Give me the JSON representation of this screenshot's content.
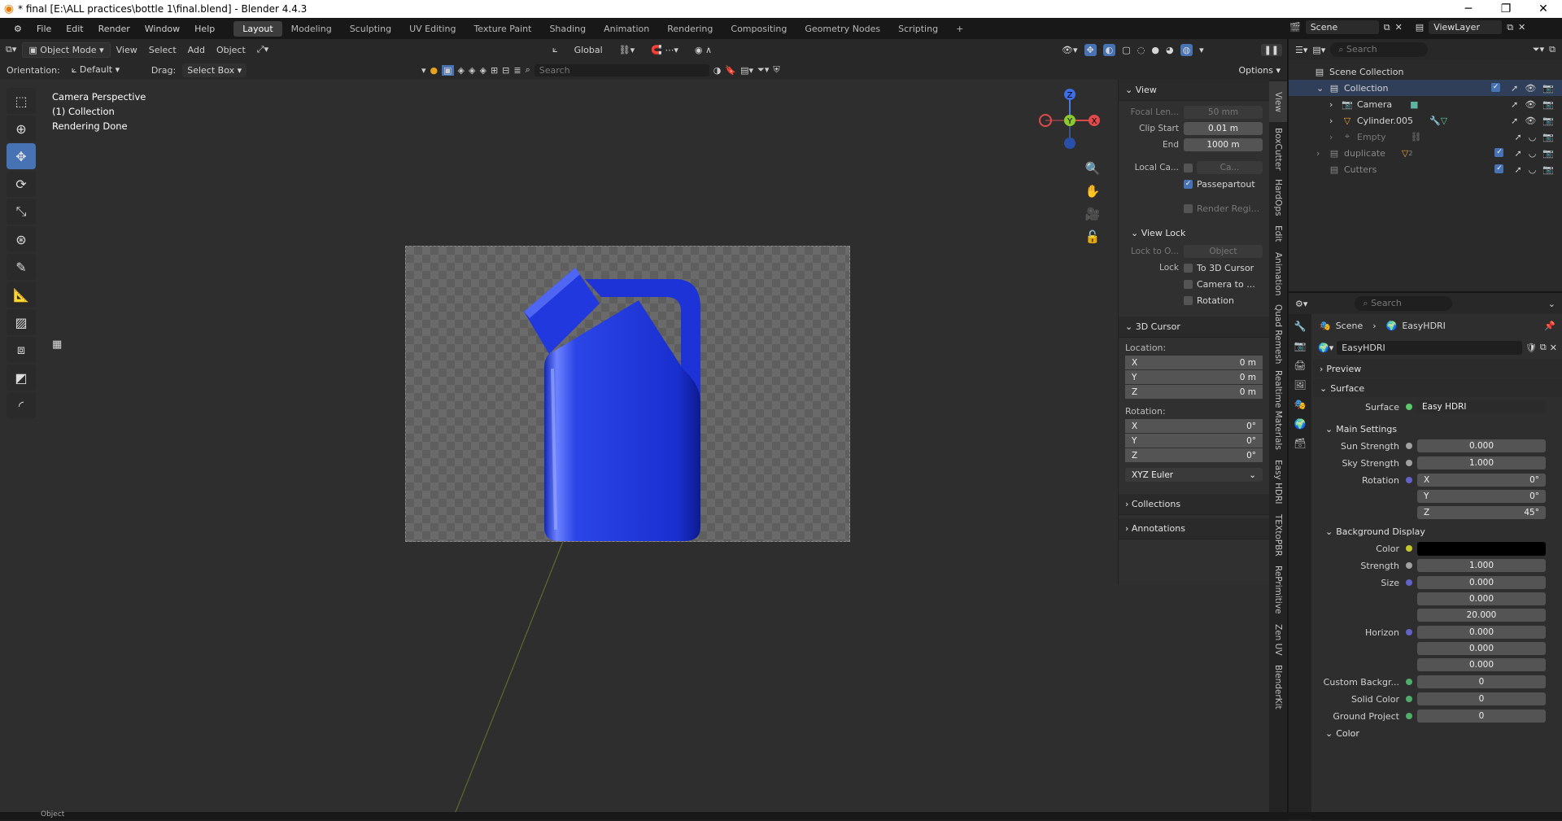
{
  "window": {
    "title": "* final [E:\\ALL practices\\bottle 1\\final.blend] - Blender 4.4.3",
    "minimize": "─",
    "restore": "❐",
    "close": "✕"
  },
  "menu": {
    "items": [
      "File",
      "Edit",
      "Render",
      "Window",
      "Help"
    ]
  },
  "workspaces": [
    "Layout",
    "Modeling",
    "Sculpting",
    "UV Editing",
    "Texture Paint",
    "Shading",
    "Animation",
    "Rendering",
    "Compositing",
    "Geometry Nodes",
    "Scripting"
  ],
  "active_workspace": "Layout",
  "scene_field": "Scene",
  "viewlayer_field": "ViewLayer",
  "header": {
    "mode": "Object Mode",
    "view": "View",
    "select": "Select",
    "add": "Add",
    "object": "Object",
    "transform_orientation": "Global",
    "orientation_label": "Orientation:",
    "orientation_value": "Default",
    "drag_label": "Drag:",
    "drag_value": "Select Box",
    "search_placeholder": "Search",
    "options": "Options"
  },
  "viewport": {
    "line1": "Camera Perspective",
    "line2": "(1) Collection",
    "line3": "Rendering Done"
  },
  "gizmo": {
    "z": "Z",
    "y": "Y",
    "x": "X"
  },
  "npanel": {
    "view_header": "View",
    "focal_label": "Focal Len...",
    "focal_value": "50 mm",
    "clip_start_label": "Clip Start",
    "clip_start_value": "0.01 m",
    "clip_end_label": "End",
    "clip_end_value": "1000 m",
    "local_cam_label": "Local Ca...",
    "local_cam_value": "Ca...",
    "passepartout": "Passepartout",
    "render_region": "Render Regi...",
    "view_lock_header": "View Lock",
    "lock_to_label": "Lock to O...",
    "lock_to_value": "Object",
    "lock_label": "Lock",
    "lock_3d_cursor": "To 3D Cursor",
    "camera_to": "Camera to ...",
    "rotation": "Rotation",
    "cursor_header": "3D Cursor",
    "location_label": "Location:",
    "loc": [
      {
        "axis": "X",
        "value": "0 m"
      },
      {
        "axis": "Y",
        "value": "0 m"
      },
      {
        "axis": "Z",
        "value": "0 m"
      }
    ],
    "rotation_label": "Rotation:",
    "rot": [
      {
        "axis": "X",
        "value": "0°"
      },
      {
        "axis": "Y",
        "value": "0°"
      },
      {
        "axis": "Z",
        "value": "0°"
      }
    ],
    "rot_mode": "XYZ Euler",
    "collections_header": "Collections",
    "annotations_header": "Annotations"
  },
  "side_tabs": [
    "View",
    "BoxCutter",
    "HardOps",
    "Edit",
    "Animation",
    "Quad Remesh",
    "Realtime Materials",
    "Easy HDRI",
    "TEXtoPBR",
    "RePrimitive",
    "Zen UV",
    "BlenderKit"
  ],
  "outliner": {
    "search_placeholder": "Search",
    "rows": [
      {
        "label": "Scene Collection"
      },
      {
        "label": "Collection"
      },
      {
        "label": "Camera"
      },
      {
        "label": "Cylinder.005"
      },
      {
        "label": "Empty"
      },
      {
        "label": "duplicate"
      },
      {
        "label": "Cutters"
      }
    ],
    "duplicate_badge": "2"
  },
  "properties": {
    "search_placeholder": "Search",
    "breadcrumb_scene": "Scene",
    "breadcrumb_world": "EasyHDRI",
    "world_name": "EasyHDRI",
    "preview": "Preview",
    "surface_header": "Surface",
    "surface_label": "Surface",
    "surface_value": "Easy HDRI",
    "main_settings": "Main Settings",
    "sun_strength_label": "Sun Strength",
    "sun_strength": "0.000",
    "sky_strength_label": "Sky Strength",
    "sky_strength": "1.000",
    "rotation_label": "Rotation",
    "rot_x_label": "X",
    "rot_x": "0°",
    "rot_y_label": "Y",
    "rot_y": "0°",
    "rot_z_label": "Z",
    "rot_z": "45°",
    "bg_display": "Background Display",
    "color_label": "Color",
    "strength_label": "Strength",
    "strength": "1.000",
    "size_label": "Size",
    "size": [
      "0.000",
      "0.000",
      "20.000"
    ],
    "horizon_label": "Horizon",
    "horizon": [
      "0.000",
      "0.000",
      "0.000"
    ],
    "custom_bg_label": "Custom Backgr...",
    "custom_bg": "0",
    "solid_color_label": "Solid Color",
    "solid_color": "0",
    "ground_project_label": "Ground Project",
    "ground_project": "0",
    "color_section": "Color"
  },
  "status": {
    "mode": "Object"
  },
  "colors": {
    "accent": "#4772b3",
    "bottle": "#1f35d6",
    "header": "#282828"
  }
}
